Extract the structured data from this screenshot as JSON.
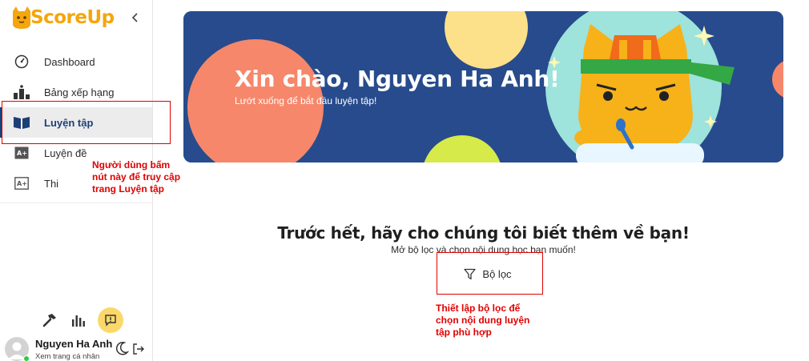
{
  "app": {
    "logo_text": "ScoreUp"
  },
  "sidebar": {
    "items": [
      {
        "label": "Dashboard",
        "icon": "dashboard-icon",
        "active": false
      },
      {
        "label": "Bảng xếp hạng",
        "icon": "leaderboard-icon",
        "active": false
      },
      {
        "label": "Luyện tập",
        "icon": "book-icon",
        "active": true
      },
      {
        "label": "Luyện đề",
        "icon": "exam-practice-icon",
        "active": false
      },
      {
        "label": "Thi",
        "icon": "exam-icon",
        "active": false
      }
    ],
    "tools": [
      "hammer-icon",
      "stats-icon",
      "feedback-icon"
    ]
  },
  "user": {
    "name": "Nguyen Ha Anh",
    "profile_link": "Xem trang cá nhân",
    "status": "online"
  },
  "banner": {
    "greeting": "Xin chào, Nguyen Ha Anh!",
    "subtitle": "Lướt xuống để bắt đầu luyện tập!"
  },
  "main": {
    "prompt_title": "Trước hết, hãy cho chúng tôi biết thêm về bạn!",
    "prompt_subtitle": "Mở bộ lọc và chọn nội dung học bạn muốn!",
    "filter_label": "Bộ lọc"
  },
  "annotations": {
    "practice_note_lines": [
      "Người dùng bấm",
      "nút này để truy cập",
      "trang Luyện tập"
    ],
    "filter_note_lines": [
      "Thiết lập bộ lọc để",
      "chọn nội dung luyện",
      "tập phù hợp"
    ]
  },
  "colors": {
    "brand": "#f4a60c",
    "banner_bg": "#274b8c",
    "active_nav": "#1d3f78",
    "annotation": "#e00000"
  }
}
